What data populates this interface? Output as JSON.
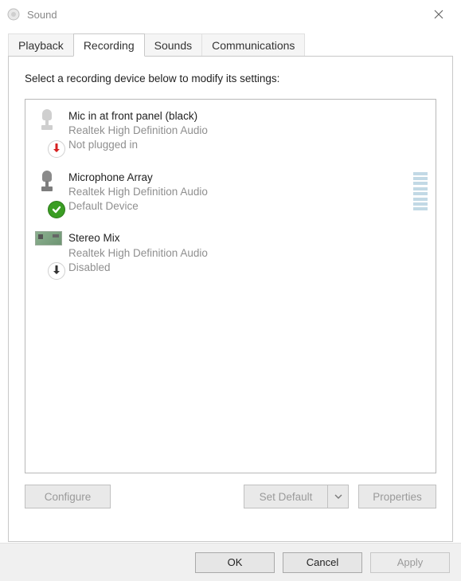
{
  "window": {
    "title": "Sound"
  },
  "tabs": [
    {
      "label": "Playback"
    },
    {
      "label": "Recording"
    },
    {
      "label": "Sounds"
    },
    {
      "label": "Communications"
    }
  ],
  "active_tab_index": 1,
  "instruction": "Select a recording device below to modify its settings:",
  "devices": [
    {
      "name": "Mic in at front panel (black)",
      "desc": "Realtek High Definition Audio",
      "status": "Not plugged in",
      "badge": "unplugged",
      "icon": "mic-dim",
      "meter": false
    },
    {
      "name": "Microphone Array",
      "desc": "Realtek High Definition Audio",
      "status": "Default Device",
      "badge": "default",
      "icon": "mic",
      "meter": true
    },
    {
      "name": "Stereo Mix",
      "desc": "Realtek High Definition Audio",
      "status": "Disabled",
      "badge": "disabled",
      "icon": "board",
      "meter": false
    }
  ],
  "panel_buttons": {
    "configure": "Configure",
    "set_default": "Set Default",
    "properties": "Properties"
  },
  "dialog_buttons": {
    "ok": "OK",
    "cancel": "Cancel",
    "apply": "Apply"
  }
}
